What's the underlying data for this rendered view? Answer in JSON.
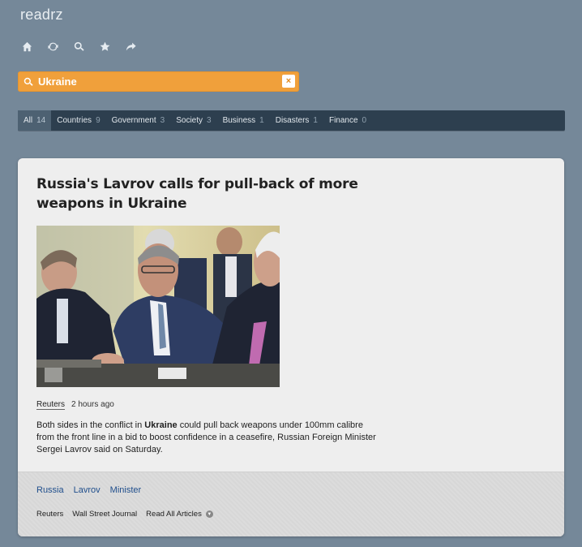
{
  "app": {
    "title": "readrz"
  },
  "toolbar": {
    "icons": [
      "home-icon",
      "refresh-icon",
      "search-icon",
      "star-icon",
      "share-icon"
    ]
  },
  "search": {
    "value": "Ukraine",
    "clear_label": "×"
  },
  "categories": [
    {
      "label": "All",
      "count": "14",
      "active": true
    },
    {
      "label": "Countries",
      "count": "9"
    },
    {
      "label": "Government",
      "count": "3"
    },
    {
      "label": "Society",
      "count": "3"
    },
    {
      "label": "Business",
      "count": "1"
    },
    {
      "label": "Disasters",
      "count": "1"
    },
    {
      "label": "Finance",
      "count": "0"
    }
  ],
  "article": {
    "headline": "Russia's Lavrov calls for pull-back of more weapons in Ukraine",
    "source": "Reuters",
    "time": "2 hours ago",
    "summary_before": "Both sides in the conflict in ",
    "summary_highlight": "Ukraine",
    "summary_after": " could pull back weapons under 100mm calibre from the front line in a bid to boost confidence in a ceasefire, Russian Foreign Minister Sergei Lavrov said on Saturday.",
    "tags": [
      "Russia",
      "Lavrov",
      "Minister"
    ],
    "sources": [
      "Reuters",
      "Wall Street Journal"
    ],
    "read_all": "Read All Articles"
  },
  "colors": {
    "background": "#758899",
    "accent": "#f0a03b",
    "navbar": "#2d3f4f",
    "tag_link": "#1f4e8c"
  }
}
